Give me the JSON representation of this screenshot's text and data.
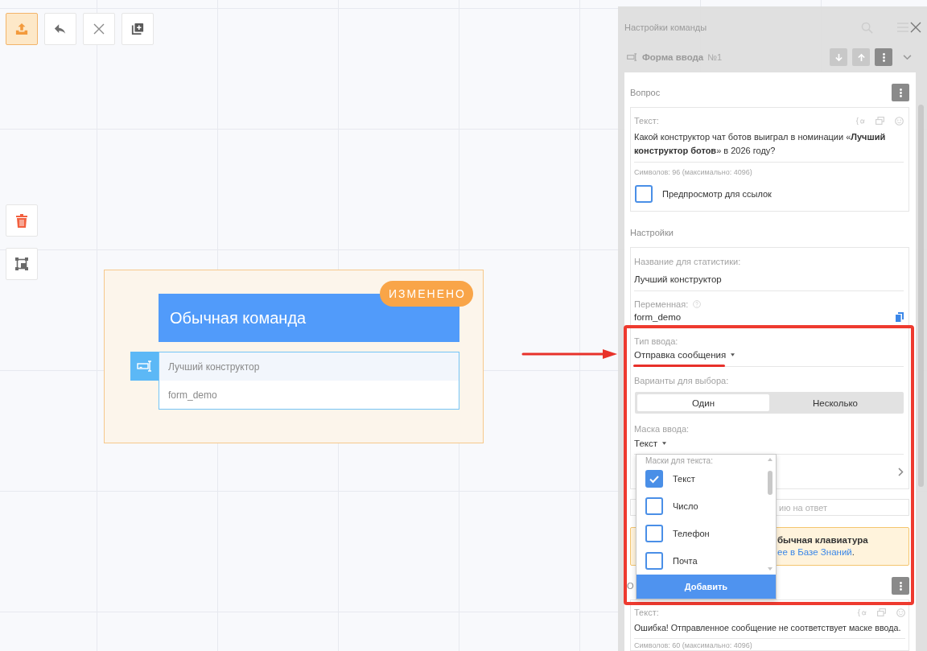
{
  "toolbar": [
    {
      "kind": "upload",
      "selected": true
    },
    {
      "kind": "undo",
      "selected": false
    },
    {
      "kind": "close",
      "selected": false
    },
    {
      "kind": "duplicate",
      "selected": false
    }
  ],
  "side_tools": [
    {
      "kind": "delete"
    },
    {
      "kind": "fit"
    }
  ],
  "node": {
    "title": "Обычная команда",
    "badge": "ИЗМЕНЕНО",
    "selected": true,
    "fields": [
      "Лучший конструктор",
      "form_demo"
    ]
  },
  "panel": {
    "title": "Настройки команды",
    "block": {
      "name": "Форма ввода",
      "number": "№1"
    },
    "question": {
      "title": "Вопрос",
      "label": "Текст:",
      "text": "Какой конструктор чат ботов выиграл в номинации «**Лучший конструктор ботов**» в 2026 году?",
      "counter": "Символов: 96 (максимально: 4096)",
      "link_preview": {
        "label": "Предпросмотр для ссылок",
        "checked": false
      }
    },
    "settings": {
      "title": "Настройки",
      "stat_name": {
        "label": "Название для статистики:",
        "value": "Лучший конструктор"
      },
      "variable": {
        "label": "Переменная:",
        "value": "form_demo"
      },
      "input_type": {
        "label": "Тип ввода:",
        "value": "Отправка сообщения"
      },
      "choice": {
        "label": "Варианты для выбора:",
        "options": [
          {
            "label": "Один",
            "selected": true
          },
          {
            "label": "Несколько",
            "selected": false
          }
        ]
      },
      "mask": {
        "label": "Маска ввода:",
        "value": "Текст"
      }
    },
    "reply_field": {
      "placeholder": "ию на ответ"
    },
    "notice": {
      "title": "бычная клавиатура",
      "link": "ее в Базе Знаний",
      "tail": "."
    },
    "error": {
      "title": "О",
      "label": "Текст:",
      "text": "Ошибка! Отправленное сообщение не соответствует маске ввода.",
      "counter": "Символов: 60 (максимально: 4096)"
    }
  },
  "mask_dropdown": {
    "header": "Маски для текста:",
    "options": [
      {
        "label": "Текст",
        "checked": true
      },
      {
        "label": "Число",
        "checked": false
      },
      {
        "label": "Телефон",
        "checked": false
      },
      {
        "label": "Почта",
        "checked": false
      }
    ],
    "button": "Добавить"
  }
}
